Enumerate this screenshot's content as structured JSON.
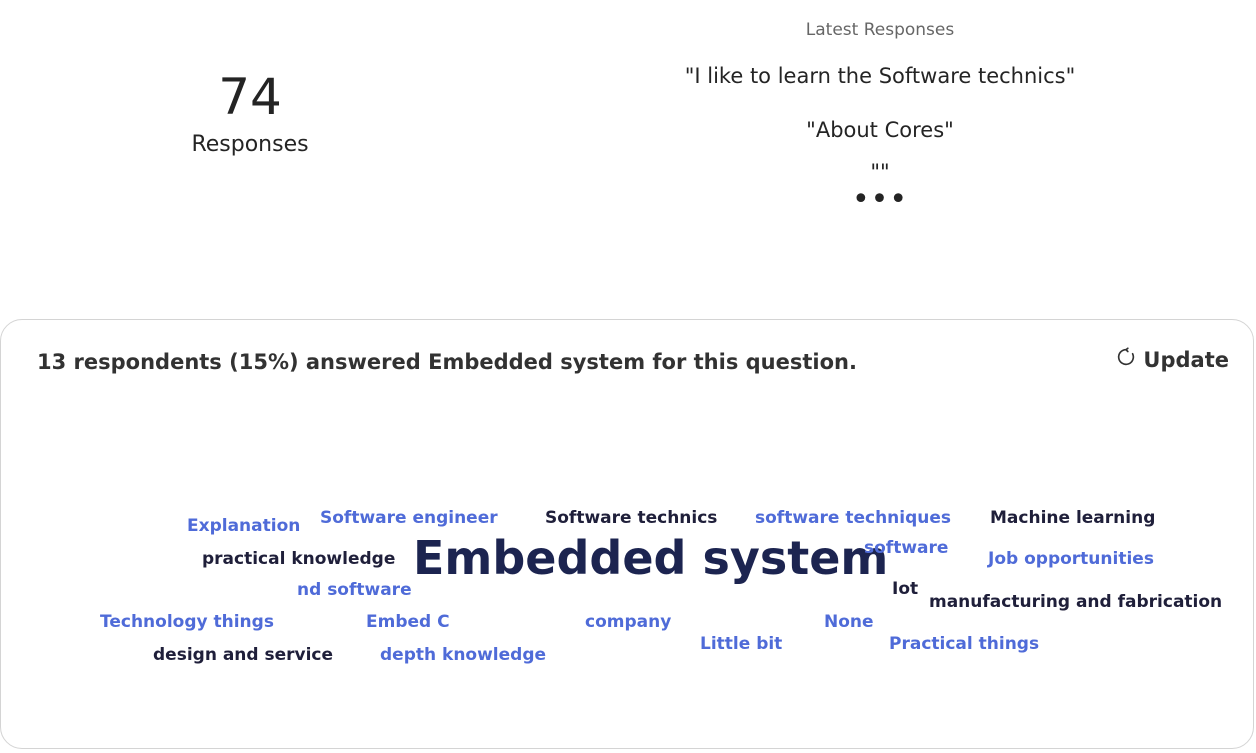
{
  "summary": {
    "count": "74",
    "count_label": "Responses"
  },
  "latest": {
    "title": "Latest Responses",
    "items": [
      "\"I like to learn the Software technics\"",
      "\"About Cores\"",
      "\"\""
    ],
    "more": "•••"
  },
  "card": {
    "summary_text": "13 respondents (15%) answered Embedded system for this question.",
    "update_label": "Update",
    "update_icon": "refresh-icon"
  },
  "cloud": {
    "words": [
      {
        "text": "Explanation",
        "tone": "light"
      },
      {
        "text": "Software engineer",
        "tone": "light"
      },
      {
        "text": "Software technics",
        "tone": "dark"
      },
      {
        "text": "software techniques",
        "tone": "light"
      },
      {
        "text": "Machine learning",
        "tone": "dark"
      },
      {
        "text": "practical knowledge",
        "tone": "dark"
      },
      {
        "text": "Embedded system",
        "tone": "dark",
        "emphasis": "largest"
      },
      {
        "text": "software",
        "tone": "light"
      },
      {
        "text": "Job opportunities",
        "tone": "light"
      },
      {
        "text": "nd software",
        "tone": "light"
      },
      {
        "text": "Iot",
        "tone": "dark"
      },
      {
        "text": "manufacturing and fabrication",
        "tone": "dark"
      },
      {
        "text": "Technology things",
        "tone": "light"
      },
      {
        "text": "Embed C",
        "tone": "light"
      },
      {
        "text": "company",
        "tone": "light"
      },
      {
        "text": "None",
        "tone": "light"
      },
      {
        "text": "Little bit",
        "tone": "light"
      },
      {
        "text": "Practical things",
        "tone": "light"
      },
      {
        "text": "design and service",
        "tone": "dark"
      },
      {
        "text": "depth knowledge",
        "tone": "light"
      }
    ],
    "colors": {
      "light": "#4f6bd8",
      "dark": "#1f1f3a",
      "largest": "#1c2450"
    }
  }
}
